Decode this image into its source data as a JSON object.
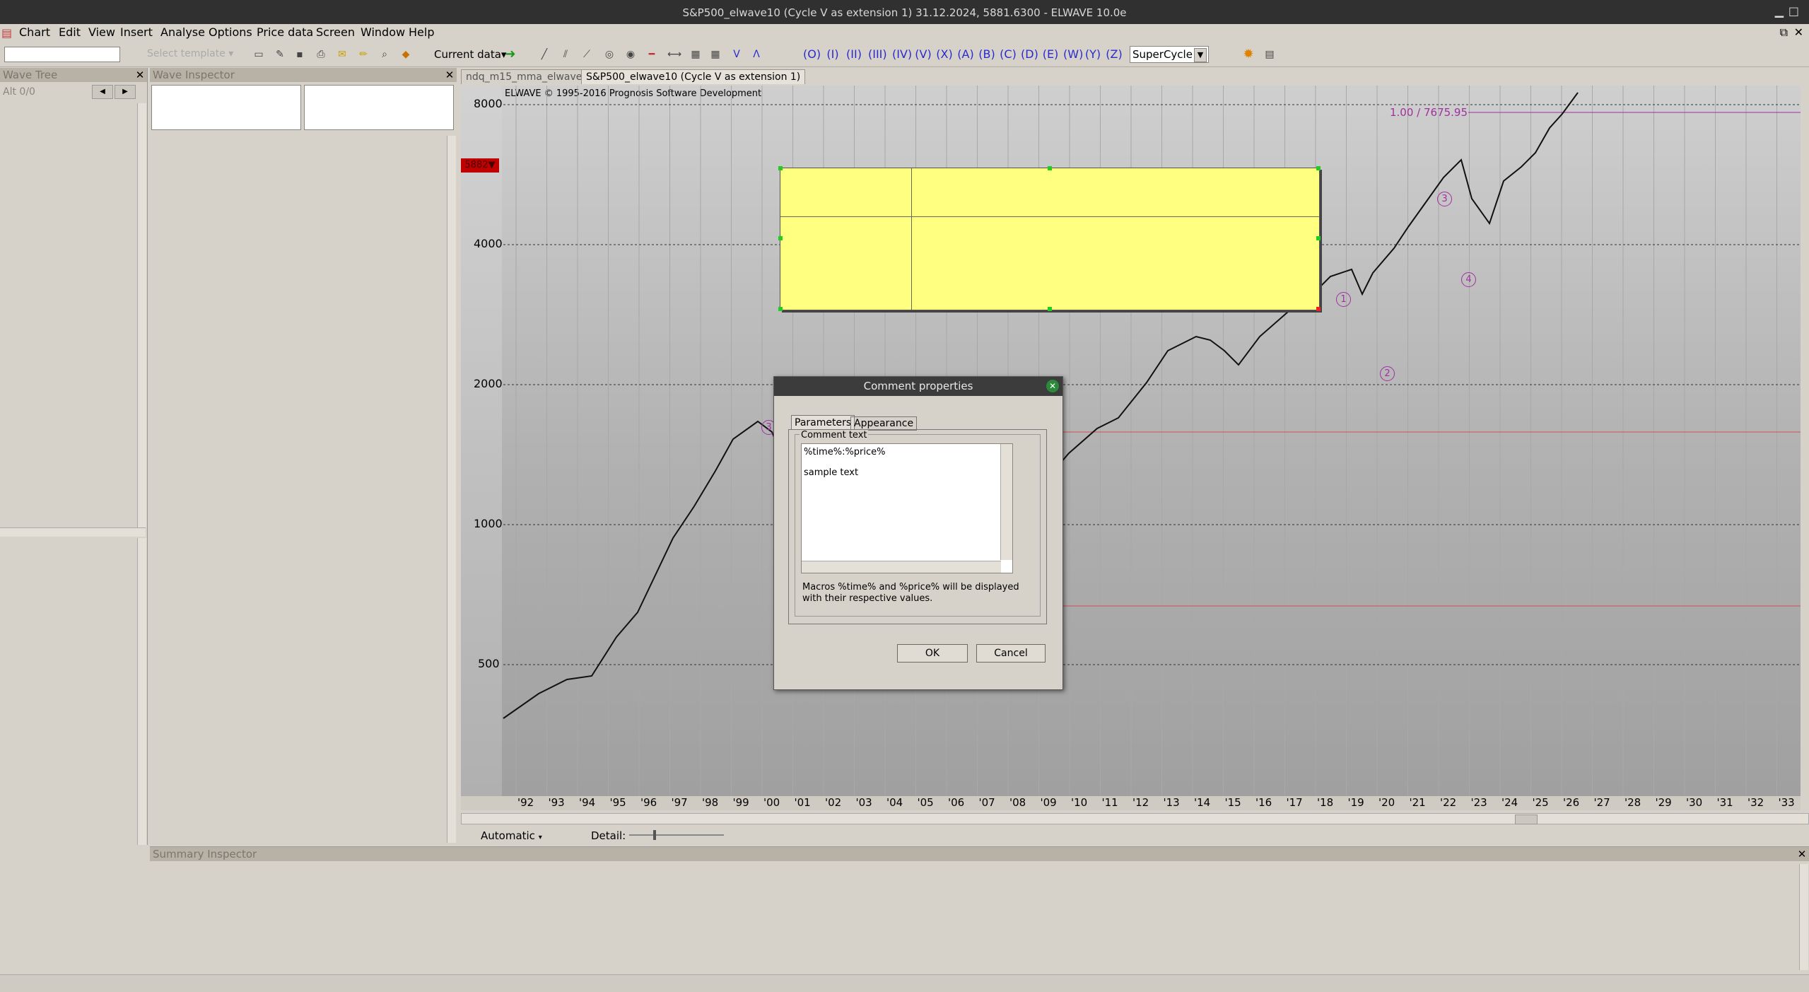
{
  "window": {
    "title": "S&P500_elwave10 (Cycle V as extension 1)  31.12.2024, 5881.6300 - ELWAVE 10.0e"
  },
  "menu": [
    "Chart",
    "Edit",
    "View",
    "Insert",
    "Analyse",
    "Options",
    "Price data",
    "Screen",
    "Window",
    "Help"
  ],
  "toolbar": {
    "template_placeholder": "Select template",
    "current_data": "Current data",
    "degree_select": "SuperCycle",
    "wave_labels": [
      "(O)",
      "(I)",
      "(II)",
      "(III)",
      "(IV)",
      "(V)",
      "(X)",
      "(A)",
      "(B)",
      "(C)",
      "(D)",
      "(E)",
      "(W)",
      "(Y)",
      "(Z)"
    ]
  },
  "wave_tree": {
    "title": "Wave Tree",
    "alt_label": "Alt 0/0"
  },
  "wave_inspector": {
    "title": "Wave Inspector"
  },
  "tabs": [
    "ndq_m15_mma_elwave10",
    "S&P500_elwave10 (Cycle V as extension 1)"
  ],
  "chart": {
    "copyright": "ELWAVE © 1995-2016 Prognosis Software Development",
    "price_marker": "5882",
    "target_label": "1.00 / 7675.95",
    "ylabels": [
      "8000",
      "4000",
      "2000",
      "1000",
      "500"
    ],
    "xlabels": [
      "'92",
      "'93",
      "'94",
      "'95",
      "'96",
      "'97",
      "'98",
      "'99",
      "'00",
      "'01",
      "'02",
      "'03",
      "'04",
      "'05",
      "'06",
      "'07",
      "'08",
      "'09",
      "'10",
      "'11",
      "'12",
      "'13",
      "'14",
      "'15",
      "'16",
      "'17",
      "'18",
      "'19",
      "'20",
      "'21",
      "'22",
      "'23",
      "'24",
      "'25",
      "'26",
      "'27",
      "'28",
      "'29",
      "'30",
      "'31",
      "'32",
      "'33"
    ],
    "wave_markers": [
      "1",
      "2",
      "3",
      "4",
      "3"
    ]
  },
  "bottom": {
    "scale_mode": "Automatic",
    "detail_label": "Detail:"
  },
  "summary": {
    "title": "Summary Inspector"
  },
  "dialog": {
    "title": "Comment properties",
    "tabs": [
      "Parameters",
      "Appearance"
    ],
    "group_label": "Comment text",
    "text_line1": "%time%:%price%",
    "text_line2": "sample text",
    "hint": "Macros %time% and %price% will be displayed with their respective values.",
    "ok": "OK",
    "cancel": "Cancel"
  }
}
